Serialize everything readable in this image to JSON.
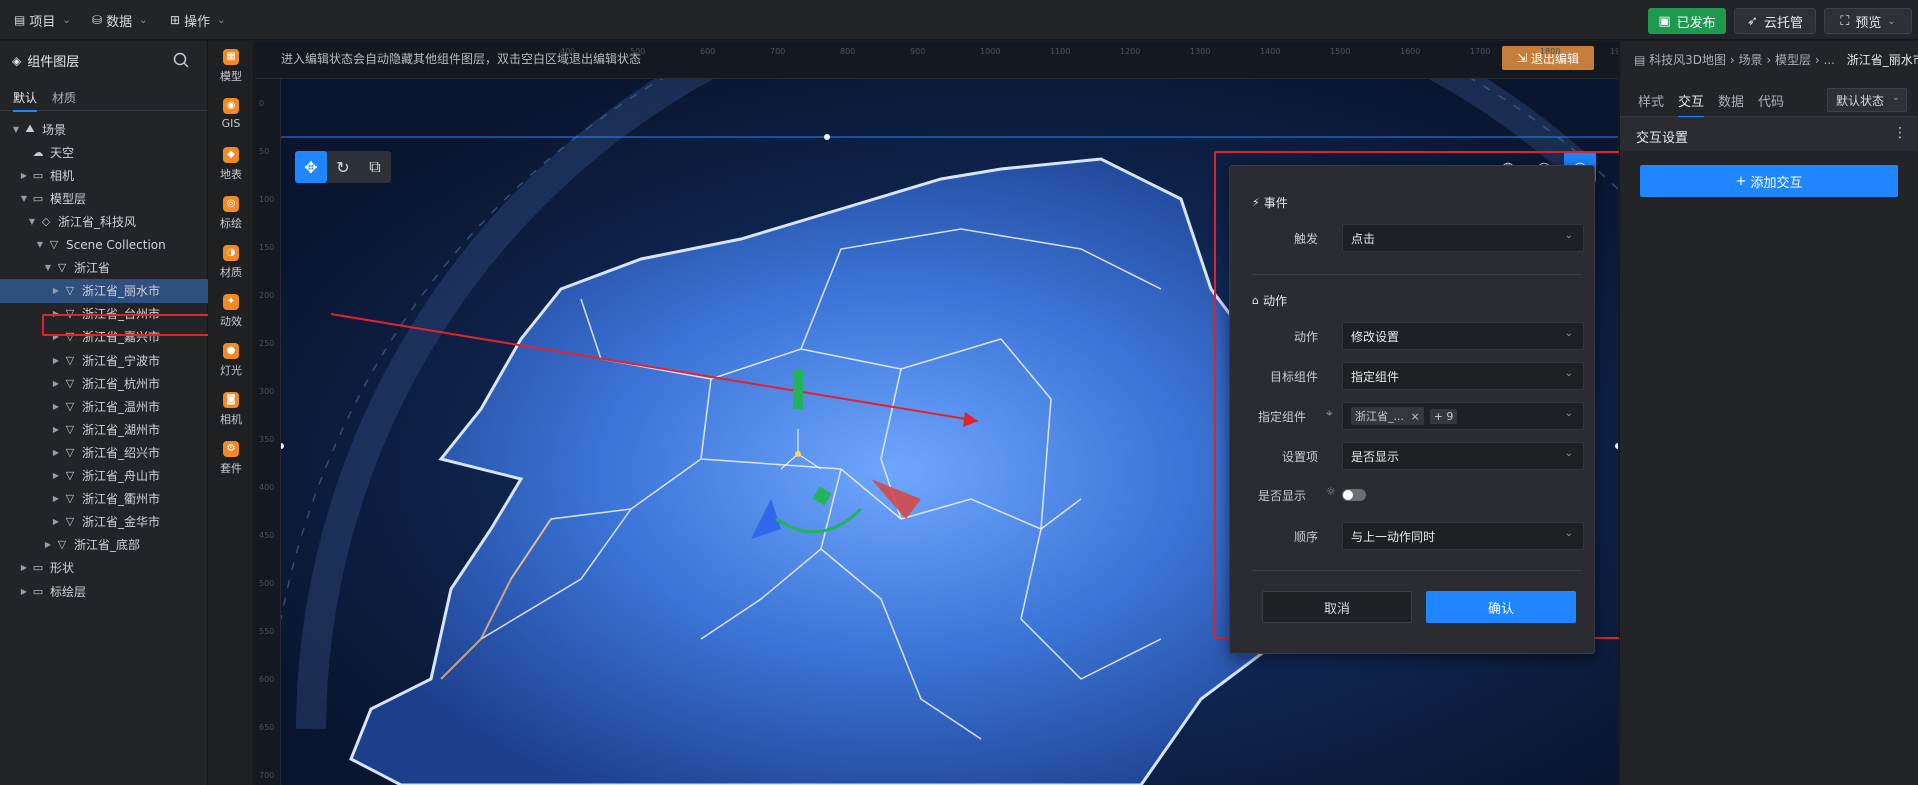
{
  "topbar": {
    "menus": [
      {
        "label": "项目",
        "icon": "document-icon"
      },
      {
        "label": "数据",
        "icon": "database-icon"
      },
      {
        "label": "操作",
        "icon": "grid-icon"
      }
    ],
    "publish_label": "已发布",
    "hosting_label": "云托管",
    "preview_label": "预览"
  },
  "left_panel": {
    "title": "组件图层",
    "tabs": [
      "默认",
      "材质"
    ],
    "tree": [
      {
        "label": "场景",
        "indent": 0,
        "expand": "open",
        "icon": "scene-icon"
      },
      {
        "label": "天空",
        "indent": 1,
        "expand": "none",
        "icon": "sky-icon"
      },
      {
        "label": "相机",
        "indent": 1,
        "expand": "closed",
        "icon": "folder-icon"
      },
      {
        "label": "模型层",
        "indent": 1,
        "expand": "open",
        "icon": "folder-icon"
      },
      {
        "label": "浙江省_科技风",
        "indent": 2,
        "expand": "open",
        "icon": "cube-icon"
      },
      {
        "label": "Scene Collection",
        "indent": 3,
        "expand": "open",
        "icon": "triangle-icon"
      },
      {
        "label": "浙江省",
        "indent": 4,
        "expand": "open",
        "icon": "triangle-icon"
      },
      {
        "label": "浙江省_丽水市",
        "indent": 5,
        "expand": "closed",
        "icon": "triangle-icon",
        "selected": true
      },
      {
        "label": "浙江省_台州市",
        "indent": 5,
        "expand": "closed",
        "icon": "triangle-icon"
      },
      {
        "label": "浙江省_嘉兴市",
        "indent": 5,
        "expand": "closed",
        "icon": "triangle-icon"
      },
      {
        "label": "浙江省_宁波市",
        "indent": 5,
        "expand": "closed",
        "icon": "triangle-icon"
      },
      {
        "label": "浙江省_杭州市",
        "indent": 5,
        "expand": "closed",
        "icon": "triangle-icon"
      },
      {
        "label": "浙江省_温州市",
        "indent": 5,
        "expand": "closed",
        "icon": "triangle-icon"
      },
      {
        "label": "浙江省_湖州市",
        "indent": 5,
        "expand": "closed",
        "icon": "triangle-icon"
      },
      {
        "label": "浙江省_绍兴市",
        "indent": 5,
        "expand": "closed",
        "icon": "triangle-icon"
      },
      {
        "label": "浙江省_舟山市",
        "indent": 5,
        "expand": "closed",
        "icon": "triangle-icon"
      },
      {
        "label": "浙江省_衢州市",
        "indent": 5,
        "expand": "closed",
        "icon": "triangle-icon"
      },
      {
        "label": "浙江省_金华市",
        "indent": 5,
        "expand": "closed",
        "icon": "triangle-icon"
      },
      {
        "label": "浙江省_底部",
        "indent": 4,
        "expand": "closed",
        "icon": "triangle-icon"
      },
      {
        "label": "形状",
        "indent": 1,
        "expand": "closed",
        "icon": "folder-icon"
      },
      {
        "label": "标绘层",
        "indent": 1,
        "expand": "closed",
        "icon": "folder-icon"
      }
    ]
  },
  "icon_strip": [
    {
      "label": "模型",
      "icon": "model-icon"
    },
    {
      "label": "GIS",
      "icon": "gis-icon"
    },
    {
      "label": "地表",
      "icon": "terrain-icon"
    },
    {
      "label": "标绘",
      "icon": "marker-icon"
    },
    {
      "label": "材质",
      "icon": "material-icon"
    },
    {
      "label": "动效",
      "icon": "effect-icon"
    },
    {
      "label": "灯光",
      "icon": "light-icon"
    },
    {
      "label": "相机",
      "icon": "camera-icon"
    },
    {
      "label": "套件",
      "icon": "kit-icon"
    }
  ],
  "canvas": {
    "hint": "进入编辑状态会自动隐藏其他组件图层，双击空白区域退出编辑状态",
    "exit_edit_label": "退出编辑",
    "ruler_top": [
      "400",
      "500",
      "600",
      "700",
      "800",
      "900",
      "1000",
      "1100",
      "1200",
      "1300",
      "1400",
      "1500",
      "1600",
      "1700",
      "1800",
      "1900"
    ],
    "ruler_left": [
      "0",
      "50",
      "100",
      "150",
      "200",
      "250",
      "300",
      "350",
      "400",
      "450",
      "500",
      "550",
      "600",
      "650",
      "700"
    ]
  },
  "popup": {
    "event_title": "事件",
    "trigger_label": "触发",
    "trigger_value": "点击",
    "action_title": "动作",
    "action_label": "动作",
    "action_value": "修改设置",
    "target_label": "目标组件",
    "target_value": "指定组件",
    "specified_label": "指定组件",
    "specified_tag": "浙江省_...",
    "specified_more": "+ 9",
    "setting_label": "设置项",
    "setting_value": "是否显示",
    "show_label": "是否显示",
    "order_label": "顺序",
    "order_value": "与上一动作同时",
    "cancel_label": "取消",
    "ok_label": "确认"
  },
  "right_panel": {
    "breadcrumb": [
      "科技风3D地图",
      "场景",
      "模型层",
      "..."
    ],
    "breadcrumb_current": "浙江省_丽水市",
    "tabs": [
      "样式",
      "交互",
      "数据",
      "代码"
    ],
    "active_tab": "交互",
    "state_value": "默认状态",
    "section_title": "交互设置",
    "add_button": "添加交互"
  },
  "colors": {
    "accent": "#1f86ff",
    "publish": "#1e9a4f",
    "exit_edit": "#c57e3b",
    "annotation": "#e2242a"
  }
}
